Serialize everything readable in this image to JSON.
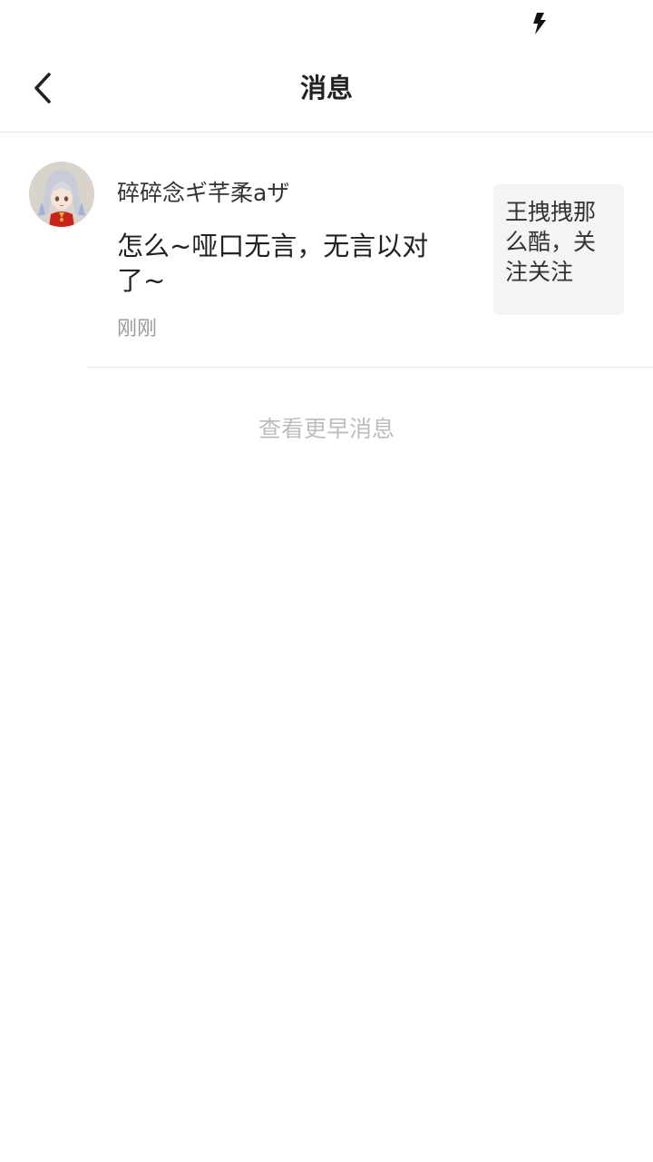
{
  "status_bar": {
    "icon": "lightning-bolt-icon"
  },
  "header": {
    "back_icon": "chevron-left-icon",
    "title": "消息"
  },
  "messages": [
    {
      "avatar_icon": "avatar-anime-girl",
      "sender": "碎碎念ギ芊柔aザ",
      "text": "怎么~哑口无言，无言以对了~",
      "time": "刚刚",
      "quote": "王拽拽那么酷，关注关注"
    }
  ],
  "footer": {
    "view_earlier": "查看更早消息"
  },
  "colors": {
    "background": "#ffffff",
    "divider": "#e6e6e6",
    "quote_background": "#f4f4f4",
    "muted_text": "#9a9a9a",
    "link_text": "#bdbdbd"
  }
}
